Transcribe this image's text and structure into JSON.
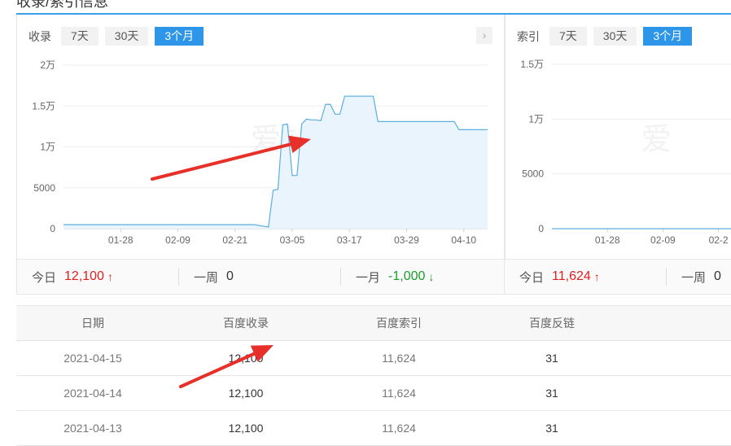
{
  "section_title": "收录/索引信息",
  "left_panel": {
    "label": "收录",
    "tabs": [
      {
        "label": "7天",
        "active": false
      },
      {
        "label": "30天",
        "active": false
      },
      {
        "label": "3个月",
        "active": true
      }
    ],
    "next_icon": "chevron-right-icon"
  },
  "right_panel": {
    "label": "索引",
    "tabs": [
      {
        "label": "7天",
        "active": false
      },
      {
        "label": "30天",
        "active": false
      },
      {
        "label": "3个月",
        "active": true
      }
    ]
  },
  "chart_data": [
    {
      "type": "area",
      "yticks": [
        "2万",
        "1.5万",
        "1万",
        "5000",
        "0"
      ],
      "ylim": [
        0,
        20000
      ],
      "xticks": [
        "01-28",
        "02-09",
        "02-21",
        "03-05",
        "03-17",
        "03-29",
        "04-10"
      ],
      "watermark": "爱站网",
      "x": [
        "01-16",
        "02-25",
        "02-28",
        "03-01",
        "03-02",
        "03-03",
        "03-04",
        "03-05",
        "03-06",
        "03-07",
        "03-08",
        "03-09",
        "03-10",
        "03-11",
        "03-12",
        "03-13",
        "03-14",
        "03-15",
        "03-16",
        "03-17",
        "03-18",
        "03-19",
        "03-20",
        "03-21",
        "03-22",
        "03-23",
        "03-24",
        "03-25",
        "03-26",
        "03-27",
        "03-28",
        "03-29",
        "03-30",
        "03-31",
        "04-08",
        "04-09",
        "04-10",
        "04-15"
      ],
      "values": [
        500,
        500,
        200,
        4700,
        4800,
        12700,
        12800,
        6500,
        6500,
        12800,
        13400,
        13300,
        13300,
        13200,
        15200,
        15200,
        14000,
        14000,
        16200,
        16200,
        16200,
        16200,
        16200,
        16200,
        16200,
        13100,
        13100,
        13100,
        13100,
        13100,
        13100,
        13100,
        13100,
        13100,
        13100,
        12100,
        12100,
        12100
      ],
      "color": "#5aaee0",
      "fill": "#eaf4fc"
    },
    {
      "type": "line",
      "yticks": [
        "1.5万",
        "1万",
        "5000",
        "0"
      ],
      "ylim": [
        0,
        15000
      ],
      "xticks": [
        "01-28",
        "02-09",
        "02-2"
      ],
      "watermark": "爱",
      "x": [
        "01-16",
        "02-25"
      ],
      "values": [
        0,
        0
      ],
      "color": "#5aaee0"
    }
  ],
  "left_stats": [
    {
      "label": "今日",
      "value": "12,100",
      "trend": "up",
      "arrow": "🠕"
    },
    {
      "label": "一周",
      "value": "0",
      "trend": "none",
      "arrow": ""
    },
    {
      "label": "一月",
      "value": "-1,000",
      "trend": "down",
      "arrow": "🠗"
    }
  ],
  "right_stats": [
    {
      "label": "今日",
      "value": "11,624",
      "trend": "up",
      "arrow": "🠕"
    },
    {
      "label": "一周",
      "value": "0",
      "trend": "none",
      "arrow": ""
    }
  ],
  "table": {
    "headers": [
      "日期",
      "百度收录",
      "百度索引",
      "百度反链"
    ],
    "rows": [
      [
        "2021-04-15",
        "12,100",
        "11,624",
        "31"
      ],
      [
        "2021-04-14",
        "12,100",
        "11,624",
        "31"
      ],
      [
        "2021-04-13",
        "12,100",
        "11,624",
        "31"
      ]
    ]
  },
  "annotation_color": "#e8302a"
}
